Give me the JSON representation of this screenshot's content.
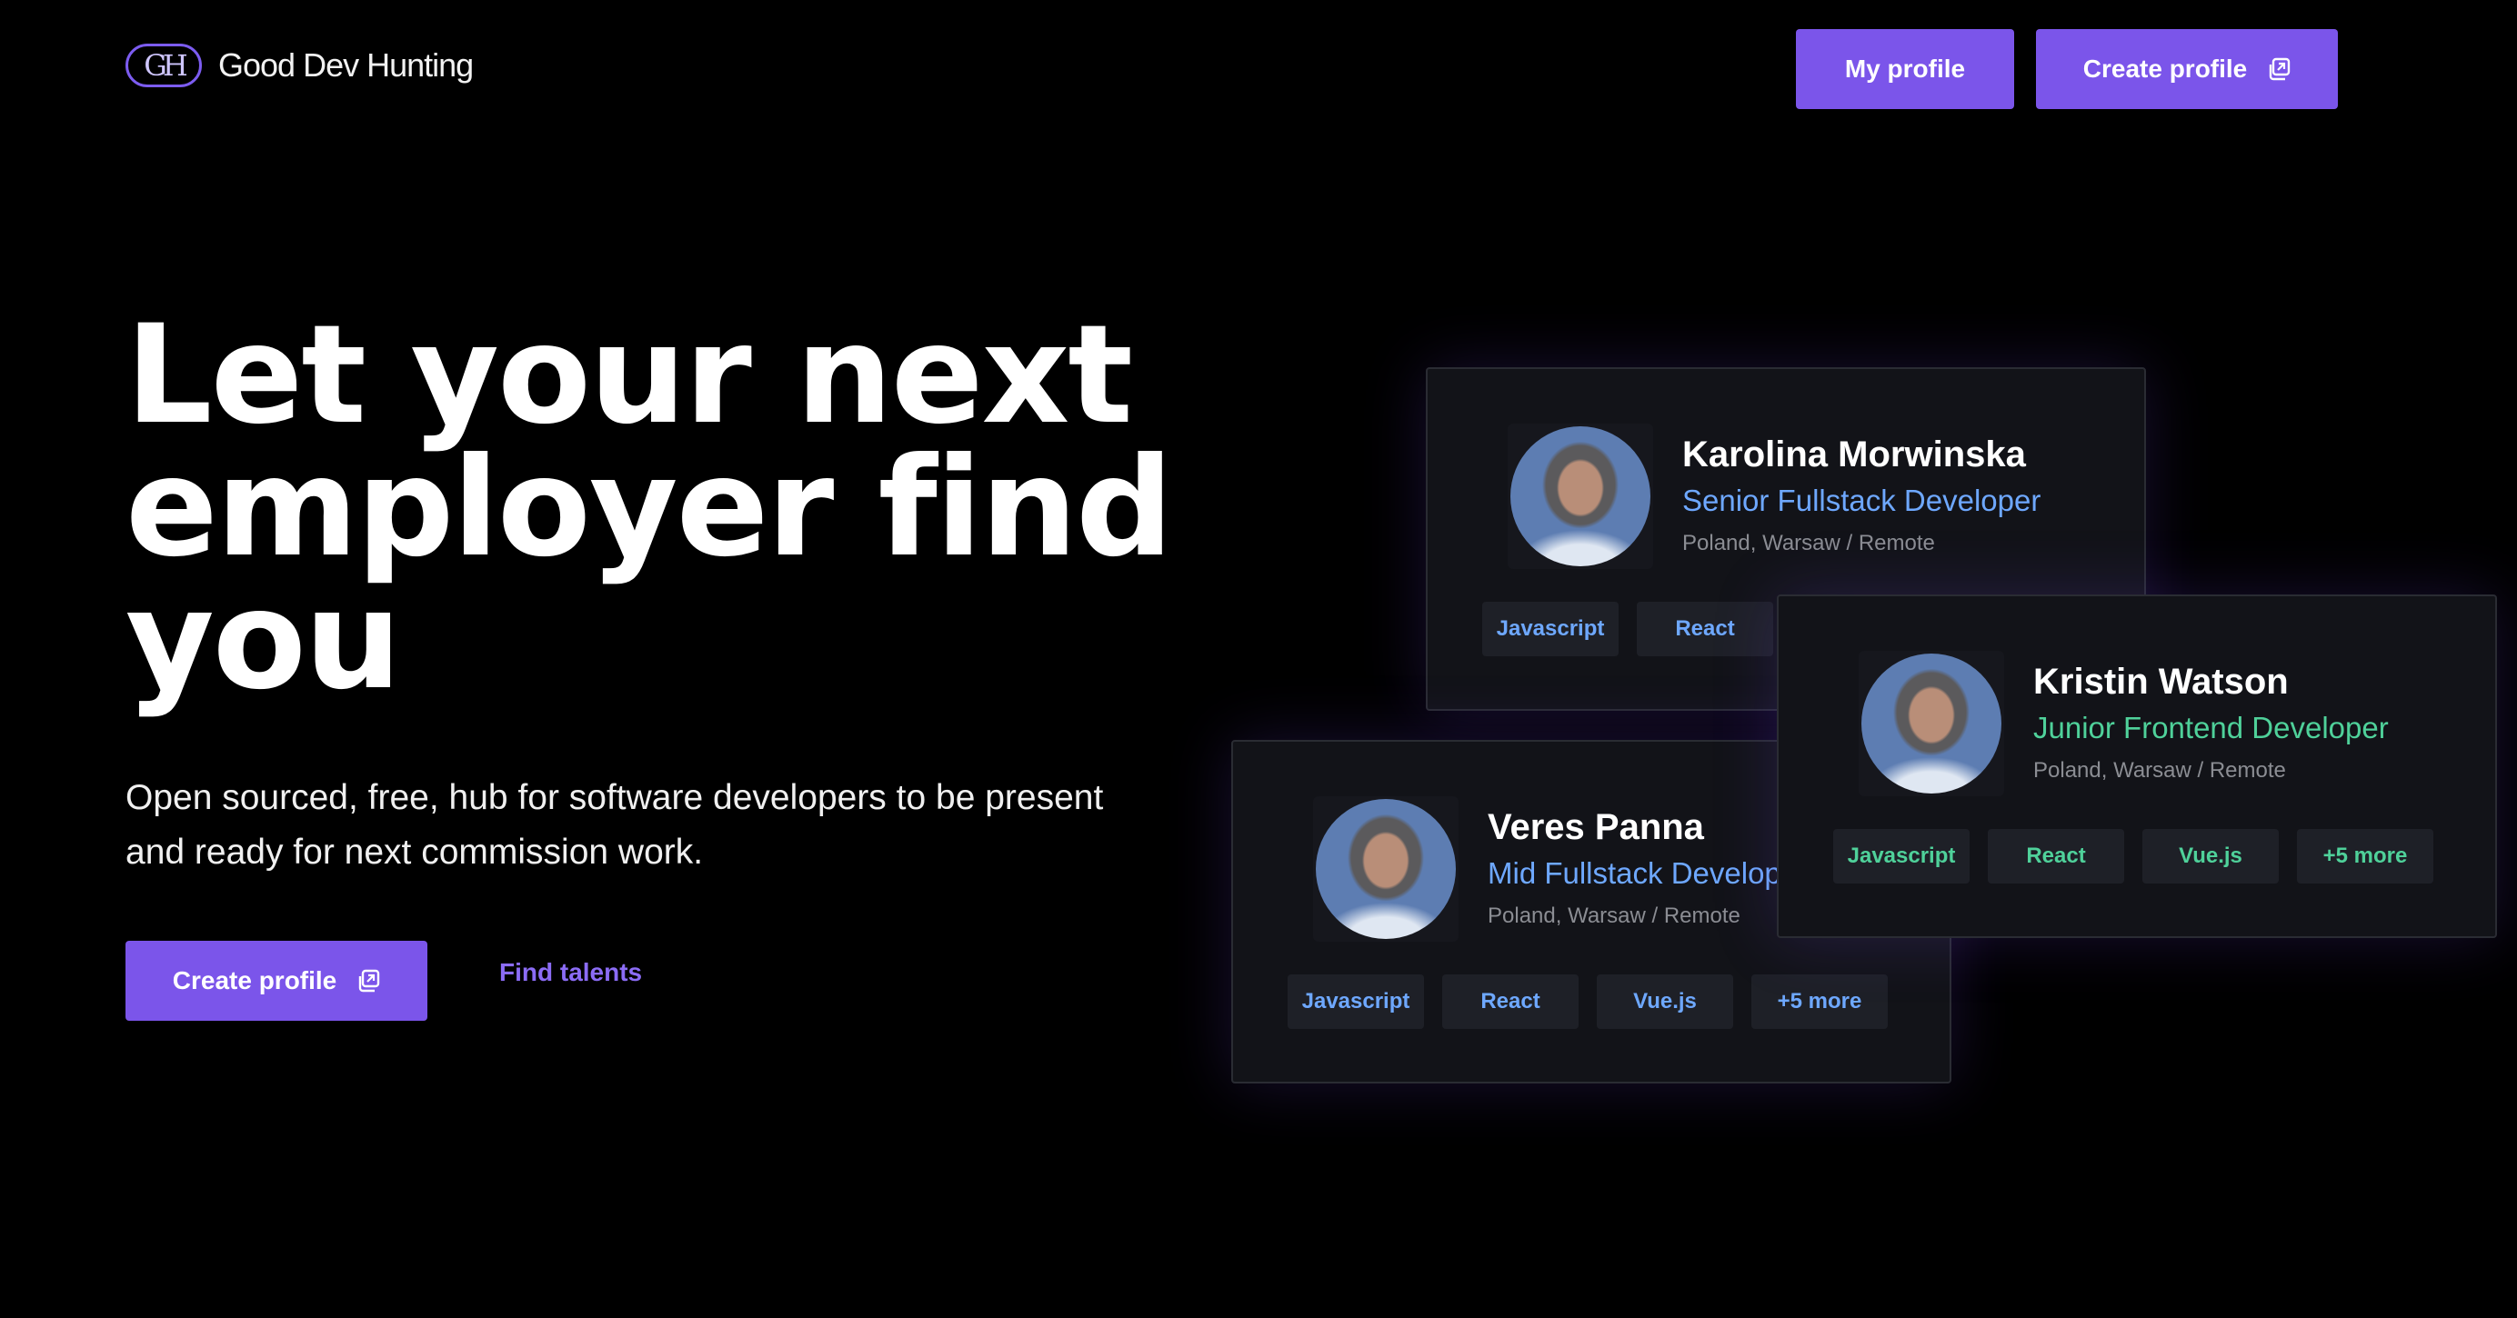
{
  "header": {
    "logo_mark": "GH",
    "logo_text": "Good Dev Hunting",
    "my_profile_label": "My profile",
    "create_profile_label": "Create profile"
  },
  "hero": {
    "title": "Let your next employer find you",
    "subtitle": "Open sourced, free, hub for software developers to be present and ready for next commission work.",
    "create_profile_label": "Create profile",
    "find_talents_label": "Find talents"
  },
  "colors": {
    "accent": "#7b55ea",
    "link": "#8b6cf5",
    "role_blue": "#6ea8ff",
    "role_green": "#4fd19a",
    "card_bg": "#121318"
  },
  "cards": [
    {
      "name": "Karolina Morwinska",
      "role": "Senior Fullstack Developer",
      "location": "Poland, Warsaw / Remote",
      "tags": [
        "Javascript",
        "React"
      ]
    },
    {
      "name": "Veres Panna",
      "role": "Mid Fullstack Developer",
      "location": "Poland, Warsaw / Remote",
      "tags": [
        "Javascript",
        "React",
        "Vue.js",
        "+5 more"
      ]
    },
    {
      "name": "Kristin Watson",
      "role": "Junior Frontend Developer",
      "location": "Poland, Warsaw / Remote",
      "tags": [
        "Javascript",
        "React",
        "Vue.js",
        "+5 more"
      ]
    }
  ]
}
